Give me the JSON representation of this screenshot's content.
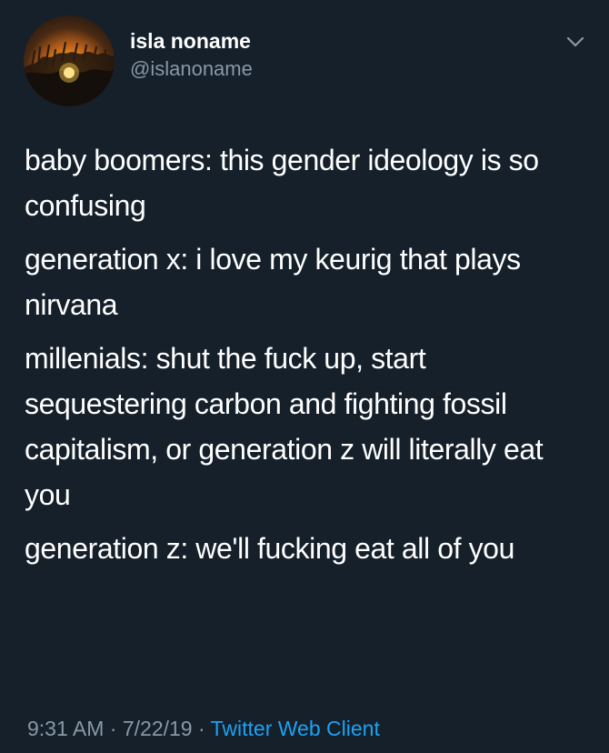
{
  "author": {
    "name": "isla noname",
    "handle": "@islanoname"
  },
  "tweet": {
    "paragraphs": [
      "baby boomers: this gender ideology is so confusing",
      "generation x: i love my keurig that plays nirvana",
      "millenials: shut the fuck up, start sequestering carbon and fighting fossil capitalism, or generation z will literally eat you",
      "generation z: we'll fucking eat all of you"
    ],
    "time": "9:31 AM",
    "separator_1": "·",
    "date": "7/22/19",
    "separator_2": "·",
    "source": "Twitter Web Client"
  },
  "icons": {
    "menu": "chevron-down-icon",
    "avatar": "sunset-avatar"
  },
  "colors": {
    "background": "#15202b",
    "primary_text": "#ffffff",
    "secondary_text": "#8899a6",
    "link": "#1da1f2"
  }
}
